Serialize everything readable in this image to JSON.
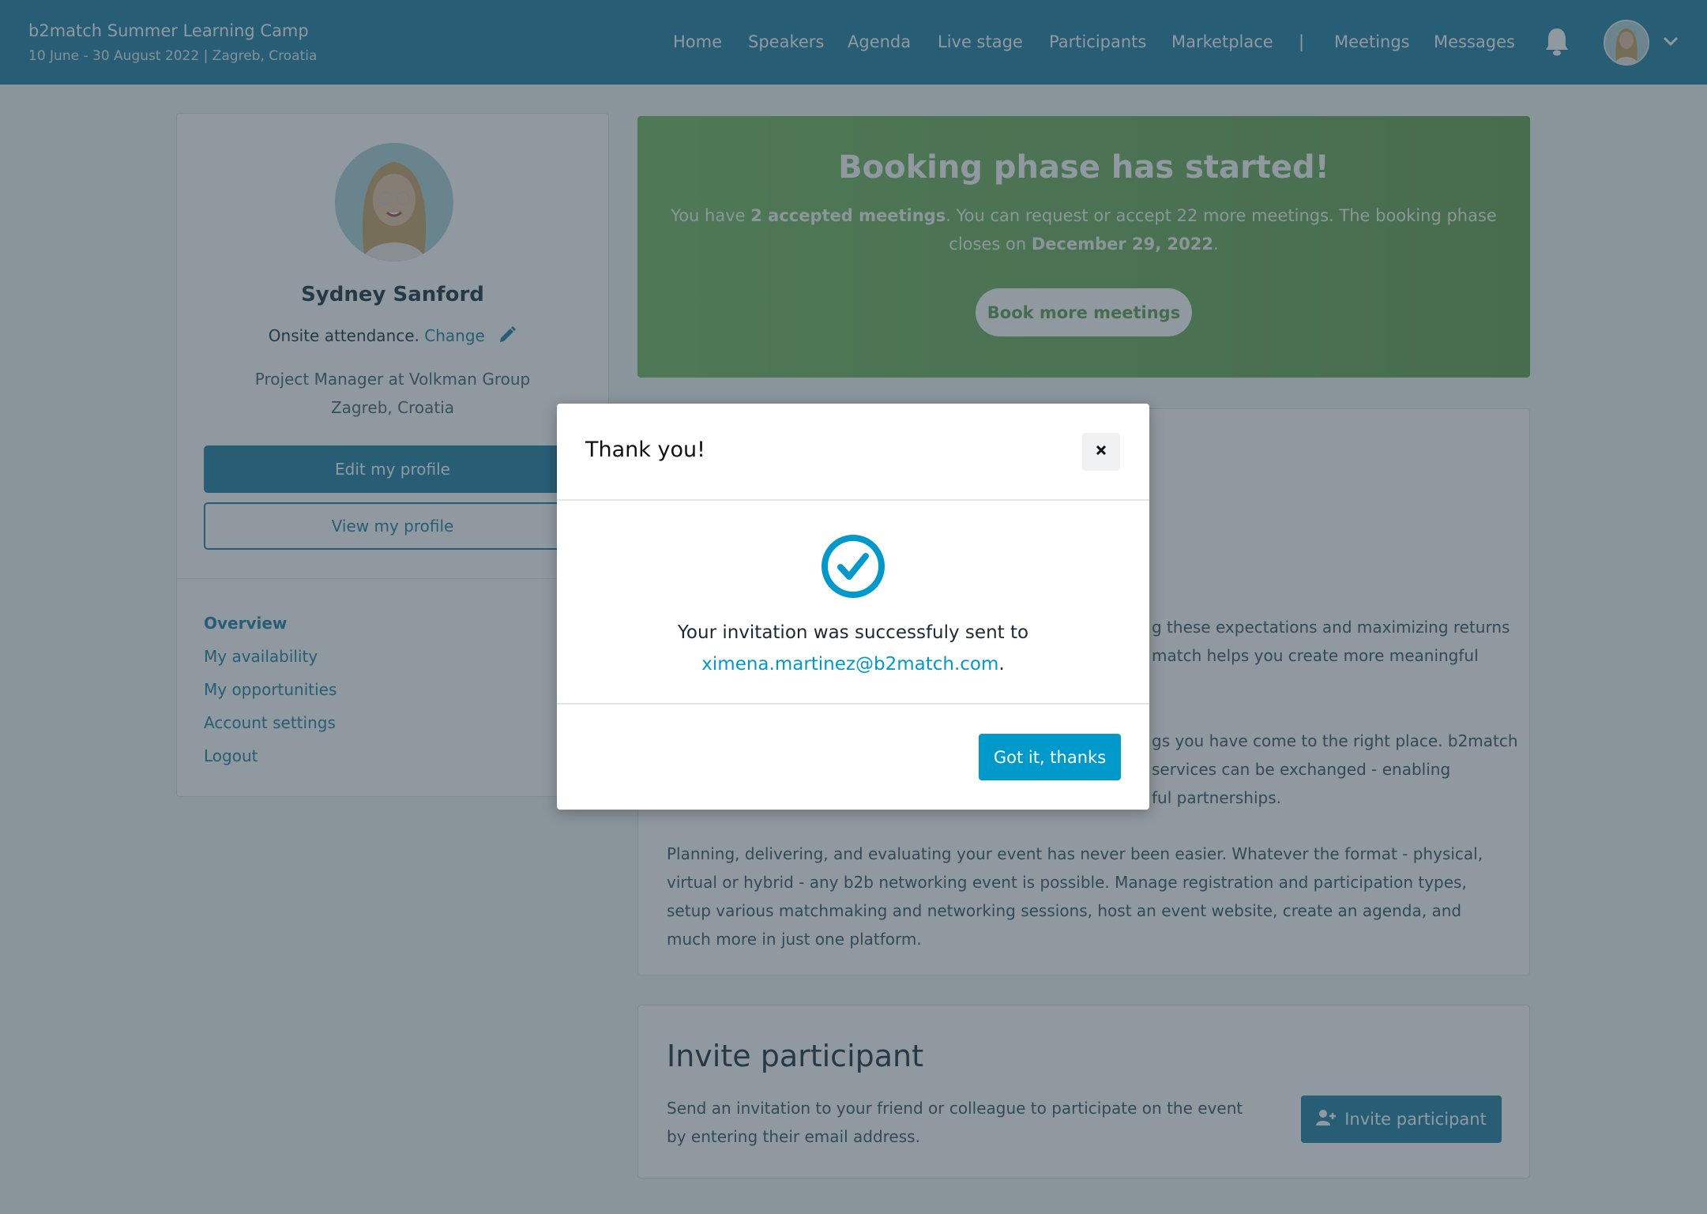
{
  "header": {
    "event_title": "b2match Summer Learning Camp",
    "event_subtitle": "10 June - 30 August 2022 | Zagreb, Croatia",
    "nav": [
      {
        "label": "Home"
      },
      {
        "label": "Speakers"
      },
      {
        "label": "Agenda"
      },
      {
        "label": "Live stage"
      },
      {
        "label": "Participants"
      },
      {
        "label": "Marketplace"
      },
      {
        "label": "|"
      },
      {
        "label": "Meetings"
      },
      {
        "label": "Messages"
      }
    ],
    "icons": {
      "notifications": "bell-icon",
      "user_menu": "chevron-down-icon"
    }
  },
  "profile": {
    "name": "Sydney Sanford",
    "attendance_text": "Onsite attendance.",
    "attendance_change_link": "Change",
    "job": "Project Manager at Volkman Group",
    "location": "Zagreb, Croatia",
    "edit_button": "Edit my profile",
    "view_button": "View my profile",
    "menu": [
      {
        "label": "Overview",
        "active": true
      },
      {
        "label": "My availability",
        "active": false
      },
      {
        "label": "My opportunities",
        "active": false
      },
      {
        "label": "Account settings",
        "active": false
      },
      {
        "label": "Logout",
        "active": false
      }
    ]
  },
  "banner": {
    "title": "Booking phase has started!",
    "text_pre": "You have ",
    "text_bold1": "2 accepted meetings",
    "text_mid": ". You can request or accept 22 more meetings. The booking phase closes on ",
    "text_bold2": "December 29, 2022",
    "text_post": ".",
    "button": "Book more meetings"
  },
  "content": {
    "para1_lines": [
      "g these expectations and maximizing returns",
      "match helps you create more meaningful"
    ],
    "para2_lines": [
      "gs you have come to the right place. b2match",
      "services can be exchanged - enabling",
      "ful partnerships."
    ],
    "para3": "Planning, delivering, and evaluating your event has never been easier. Whatever the format - physical, virtual or hybrid - any b2b networking event is possible. Manage registration and participation types, setup various matchmaking and networking sessions, host an event website, create an agenda, and much more in just one platform."
  },
  "invite": {
    "title": "Invite participant",
    "text": "Send an invitation to your friend or colleague to participate on the event by entering their email address.",
    "button": "Invite participant"
  },
  "modal": {
    "title": "Thank you!",
    "close_label": "×",
    "message": "Your invitation was successfuly sent to",
    "email": "ximena.martinez@b2match.com",
    "email_suffix": ".",
    "ok_button": "Got it, thanks"
  },
  "colors": {
    "brand": "#2f87ab",
    "modal_accent": "#0099cc",
    "banner_green": "#7ebd6e"
  }
}
